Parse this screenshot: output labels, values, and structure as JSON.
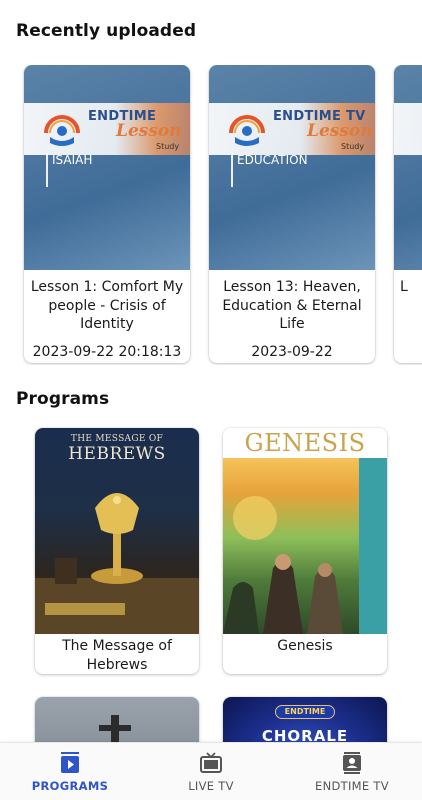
{
  "colors": {
    "accent": "#2f55c9",
    "inactive": "#555555"
  },
  "sections": {
    "recent_title": "Recently uploaded",
    "programs_title": "Programs"
  },
  "recent": [
    {
      "brand": "ENDTIME",
      "overlay": "Lesson",
      "study": "Study",
      "topic": "ISAIAH",
      "title": "Lesson 1: Comfort My people - Crisis of Identity",
      "date": "2023-09-22 20:18:13"
    },
    {
      "brand": "ENDTIME TV",
      "overlay": "Lesson",
      "study": "Study",
      "topic": "EDUCATION",
      "title": "Lesson 13: Heaven, Education & Eternal Life",
      "date": "2023-09-22"
    },
    {
      "title": "L"
    }
  ],
  "programs": [
    {
      "art_line1": "THE MESSAGE OF",
      "art_line2": "HEBREWS",
      "title": "The Message of Hebrews"
    },
    {
      "art_title": "GENESIS",
      "title": "Genesis"
    },
    {
      "title": ""
    },
    {
      "art_badge": "ENDTIME",
      "art_title": "CHORALE",
      "title": ""
    }
  ],
  "nav": [
    {
      "label": "PROGRAMS",
      "icon": "programs-icon",
      "active": true
    },
    {
      "label": "LIVE TV",
      "icon": "tv-icon",
      "active": false
    },
    {
      "label": "ENDTIME TV",
      "icon": "contact-card-icon",
      "active": false
    }
  ]
}
